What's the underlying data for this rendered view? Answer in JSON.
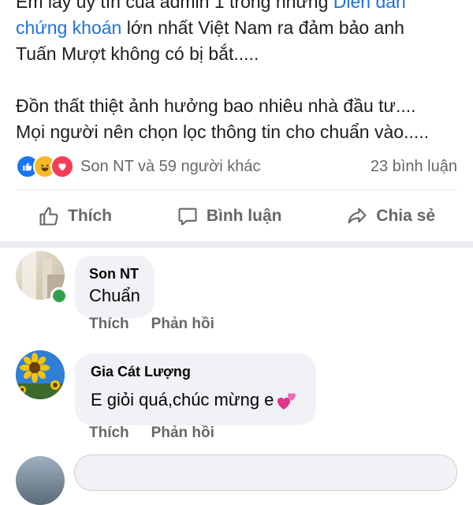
{
  "post": {
    "line1_prefix": "Em lấy uy tín của admin 1 trong những ",
    "line1_link": "Diễn đàn",
    "line2_link": "chứng khoán",
    "line2_rest": " lớn nhất Việt Nam ra đảm bảo anh",
    "line3": "Tuấn Mượt không có bị bắt.....",
    "line5": "Đồn thất thiệt ảnh hưởng bao nhiêu nhà đầu tư....",
    "line6": "Mọi người nên chọn lọc thông tin cho chuẩn vào....."
  },
  "reactions": {
    "types": [
      "like-icon",
      "haha-icon",
      "love-icon"
    ],
    "summary": "Son NT và 59 người khác",
    "comments_count": "23 bình luận"
  },
  "actions": {
    "like": "Thích",
    "comment": "Bình luận",
    "share": "Chia sẻ"
  },
  "comments": [
    {
      "author": "Son NT",
      "text": "Chuẩn",
      "like": "Thích",
      "reply": "Phản hồi",
      "online": true
    },
    {
      "author": "Gia Cát Lượng",
      "text": "E giỏi quá,chúc mừng e",
      "emoji": "two-hearts-icon",
      "like": "Thích",
      "reply": "Phản hồi"
    }
  ],
  "colors": {
    "link": "#216fdb",
    "secondary_text": "#65676b",
    "bubble": "#f0f2f5",
    "like_blue": "#1877f2",
    "haha_yellow": "#f7b928",
    "love_red": "#f33e58",
    "online_green": "#31a24c"
  }
}
